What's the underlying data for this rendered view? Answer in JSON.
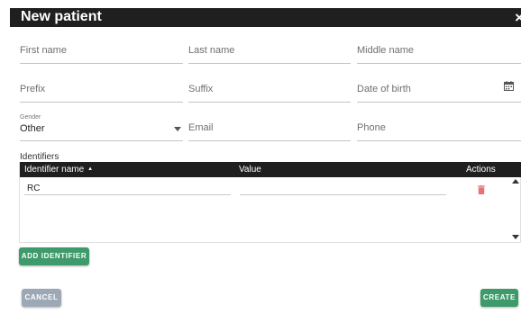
{
  "dialog": {
    "title": "New patient",
    "close_label": "×"
  },
  "form": {
    "first_name_placeholder": "First name",
    "last_name_placeholder": "Last name",
    "middle_name_placeholder": "Middle name",
    "prefix_placeholder": "Prefix",
    "suffix_placeholder": "Suffix",
    "dob_placeholder": "Date of birth",
    "gender_label": "Gender",
    "gender_value": "Other",
    "email_placeholder": "Email",
    "phone_placeholder": "Phone"
  },
  "identifiers": {
    "section_label": "Identifiers",
    "columns": {
      "name": "Identifier name",
      "value": "Value",
      "actions": "Actions"
    },
    "sort_icon": "sort-ascending-icon",
    "rows": [
      {
        "name": "RC",
        "value": ""
      }
    ]
  },
  "buttons": {
    "add_identifier": "ADD IDENTIFIER",
    "cancel": "CANCEL",
    "create": "CREATE"
  },
  "colors": {
    "header_bg": "#1f1f1f",
    "primary_green": "#3e9a6b",
    "cancel_gray": "#9da8b7",
    "delete_red": "#e57373"
  },
  "icons": {
    "calendar": "calendar-icon",
    "trash": "trash-icon",
    "close": "close-icon",
    "dropdown": "chevron-down-icon"
  }
}
